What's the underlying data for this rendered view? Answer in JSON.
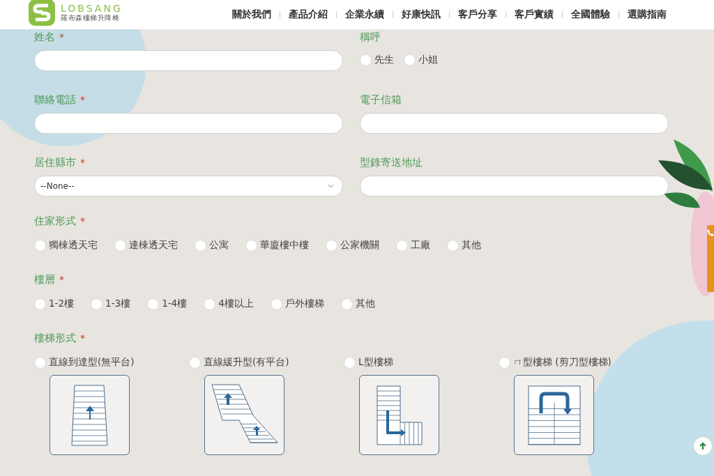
{
  "header": {
    "brand": "LOBSANG",
    "subtitle": "羅布森樓梯升降椅",
    "nav": [
      {
        "label": "關於我們"
      },
      {
        "label": "產品介紹"
      },
      {
        "label": "企業永續"
      },
      {
        "label": "好康快訊"
      },
      {
        "label": "客戶分享"
      },
      {
        "label": "客戶實績"
      },
      {
        "label": "全國體驗"
      },
      {
        "label": "選購指南"
      }
    ]
  },
  "form": {
    "pairs": [
      [
        {
          "label": "姓名",
          "required_mark": "*",
          "kind": "text"
        },
        {
          "label": "稱呼",
          "kind": "radio",
          "options": [
            {
              "label": "先生",
              "selected": false
            },
            {
              "label": "小姐",
              "selected": false
            }
          ]
        }
      ],
      [
        {
          "label": "聯絡電話",
          "required_mark": "*",
          "kind": "text"
        },
        {
          "label": "電子信箱",
          "kind": "text"
        }
      ],
      [
        {
          "label": "居住縣市",
          "required_mark": "*",
          "kind": "select",
          "value": "--None--"
        },
        {
          "label": "型錄寄送地址",
          "kind": "text"
        }
      ]
    ],
    "groups": [
      {
        "label": "住家形式",
        "required_mark": "*",
        "options": [
          {
            "label": "獨棟透天宅",
            "selected": false
          },
          {
            "label": "連棟透天宅",
            "selected": false
          },
          {
            "label": "公寓",
            "selected": false
          },
          {
            "label": "華廈樓中樓",
            "selected": false
          },
          {
            "label": "公家機關",
            "selected": false
          },
          {
            "label": "工廠",
            "selected": false
          },
          {
            "label": "其他",
            "selected": false
          }
        ]
      },
      {
        "label": "樓層",
        "required_mark": "*",
        "options": [
          {
            "label": "1-2樓",
            "selected": false
          },
          {
            "label": "1-3樓",
            "selected": false
          },
          {
            "label": "1-4樓",
            "selected": false
          },
          {
            "label": "4樓以上",
            "selected": false
          },
          {
            "label": "戶外樓梯",
            "selected": false
          },
          {
            "label": "其他",
            "selected": false
          }
        ]
      }
    ],
    "stairs": {
      "label": "樓梯形式",
      "required_mark": "*",
      "options": [
        {
          "label": "直線到達型(無平台)",
          "selected": false,
          "kind": "straight"
        },
        {
          "label": "直線緩升型(有平台)",
          "selected": false,
          "kind": "landing"
        },
        {
          "label": "L型樓梯",
          "selected": false,
          "kind": "l"
        },
        {
          "label": "ㄇ型樓梯 (剪刀型樓梯)",
          "selected": false,
          "kind": "u"
        }
      ]
    }
  }
}
